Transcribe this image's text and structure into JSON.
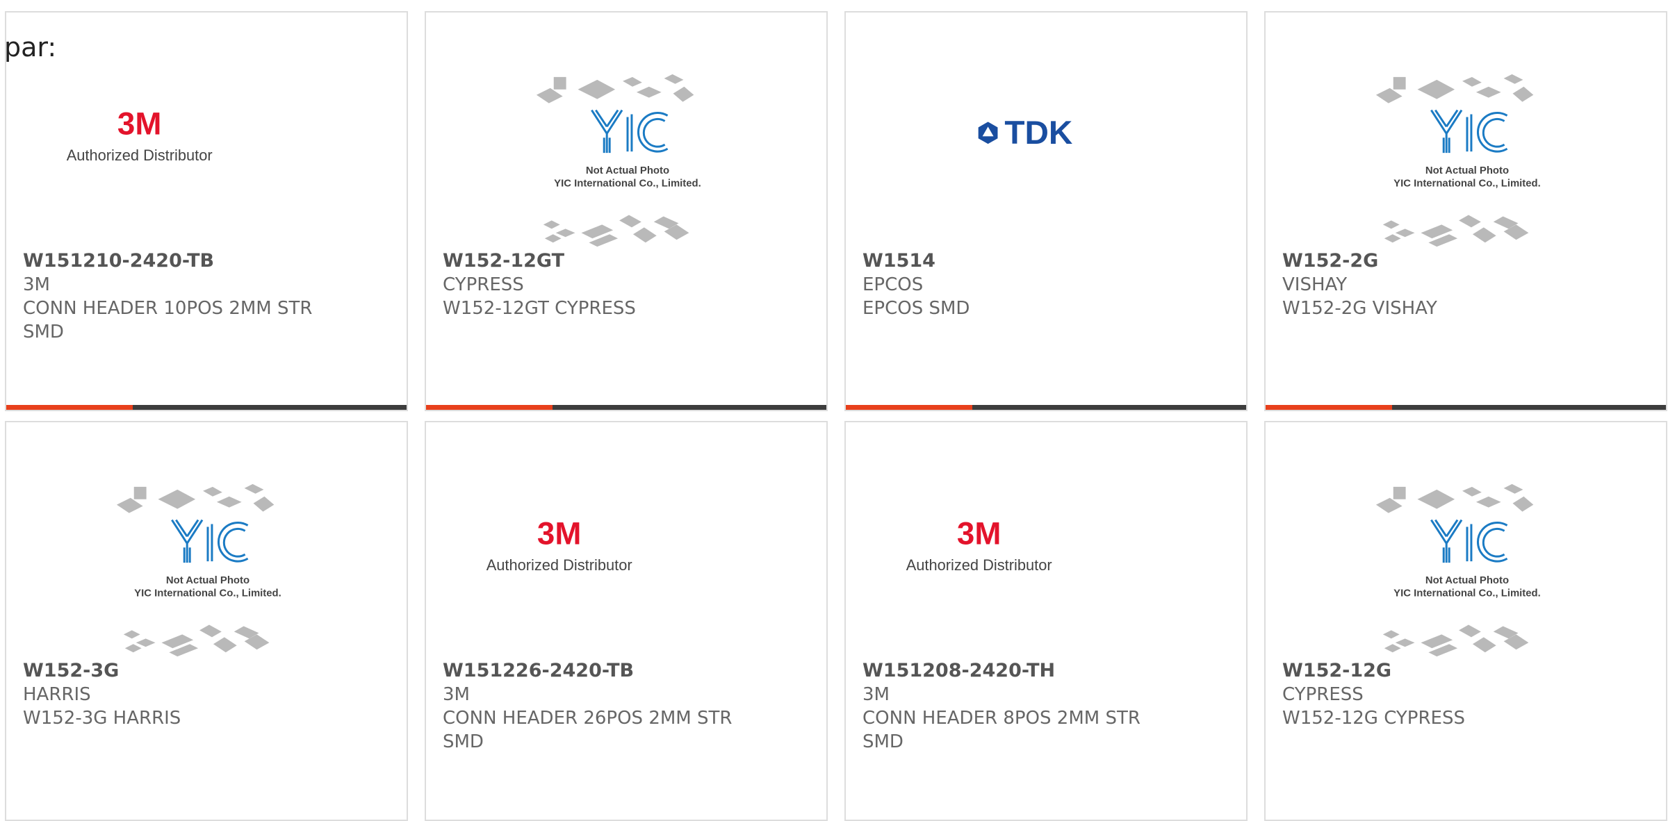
{
  "header_text": "par:",
  "colors": {
    "accent": "#e8401c",
    "bar": "#3d3d3d",
    "border": "#dddddd",
    "text": "#555555"
  },
  "products": [
    {
      "part_number": "W151210-2420-TB",
      "manufacturer": "3M",
      "description": "CONN HEADER 10POS 2MM STR SMD",
      "image": {
        "type": "brand-3m",
        "brand": "3M",
        "caption": "Authorized Distributor"
      }
    },
    {
      "part_number": "W152-12GT",
      "manufacturer": "CYPRESS",
      "description": "W152-12GT CYPRESS",
      "image": {
        "type": "yic-placeholder",
        "brand": "YIC",
        "caption": "Not Actual Photo",
        "caption2": "YIC International Co., Limited."
      }
    },
    {
      "part_number": "W1514",
      "manufacturer": "EPCOS",
      "description": "EPCOS SMD",
      "image": {
        "type": "brand-tdk",
        "brand": "TDK"
      }
    },
    {
      "part_number": "W152-2G",
      "manufacturer": "VISHAY",
      "description": "W152-2G VISHAY",
      "image": {
        "type": "yic-placeholder",
        "brand": "YIC",
        "caption": "Not Actual Photo",
        "caption2": "YIC International Co., Limited."
      }
    },
    {
      "part_number": "W152-3G",
      "manufacturer": "HARRIS",
      "description": "W152-3G HARRIS",
      "image": {
        "type": "yic-placeholder",
        "brand": "YIC",
        "caption": "Not Actual Photo",
        "caption2": "YIC International Co., Limited."
      }
    },
    {
      "part_number": "W151226-2420-TB",
      "manufacturer": "3M",
      "description": "CONN HEADER 26POS 2MM STR SMD",
      "image": {
        "type": "brand-3m",
        "brand": "3M",
        "caption": "Authorized Distributor"
      }
    },
    {
      "part_number": "W151208-2420-TH",
      "manufacturer": "3M",
      "description": "CONN HEADER 8POS 2MM STR SMD",
      "image": {
        "type": "brand-3m",
        "brand": "3M",
        "caption": "Authorized Distributor"
      }
    },
    {
      "part_number": "W152-12G",
      "manufacturer": "CYPRESS",
      "description": "W152-12G CYPRESS",
      "image": {
        "type": "yic-placeholder",
        "brand": "YIC",
        "caption": "Not Actual Photo",
        "caption2": "YIC International Co., Limited."
      }
    }
  ]
}
